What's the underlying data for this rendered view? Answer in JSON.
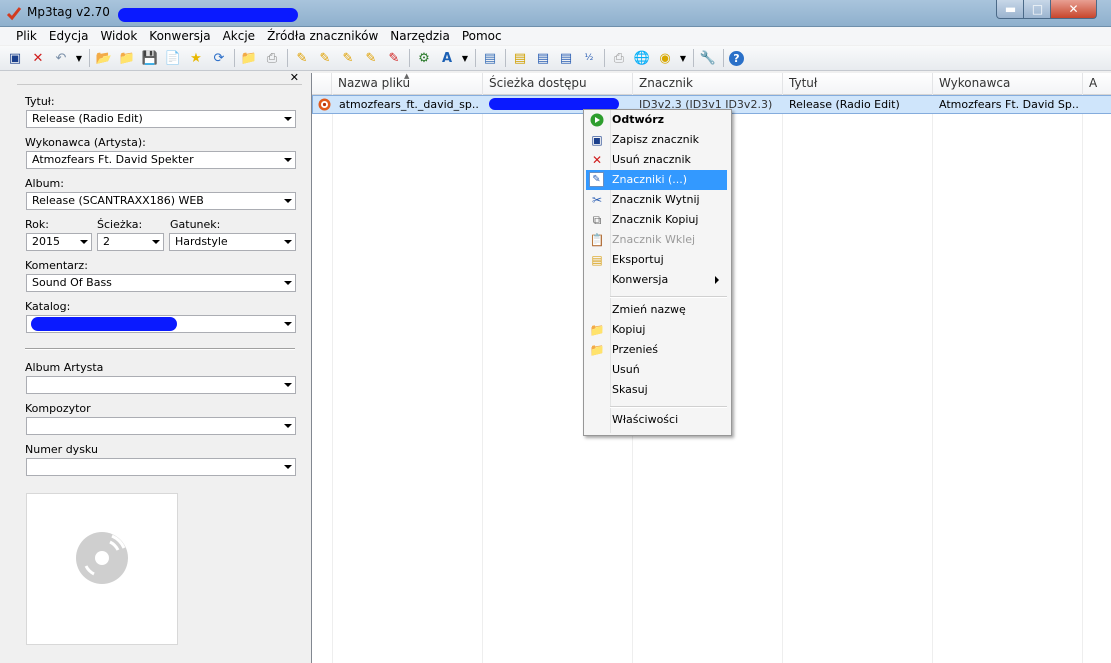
{
  "app": {
    "title": "Mp3tag v2.70"
  },
  "menu": [
    "Plik",
    "Edycja",
    "Widok",
    "Konwersja",
    "Akcje",
    "Źródła znaczników",
    "Narzędzia",
    "Pomoc"
  ],
  "fields": {
    "title": {
      "label": "Tytuł:",
      "value": "Release (Radio Edit)"
    },
    "artist": {
      "label": "Wykonawca (Artysta):",
      "value": "Atmozfears Ft. David Spekter"
    },
    "album": {
      "label": "Album:",
      "value": "Release (SCANTRAXX186) WEB"
    },
    "year": {
      "label": "Rok:",
      "value": "2015"
    },
    "track": {
      "label": "Ścieżka:",
      "value": "2"
    },
    "genre": {
      "label": "Gatunek:",
      "value": "Hardstyle"
    },
    "comment": {
      "label": "Komentarz:",
      "value": "Sound Of Bass"
    },
    "catalog": {
      "label": "Katalog:",
      "value": ""
    },
    "album_artist": {
      "label": "Album Artysta",
      "value": ""
    },
    "composer": {
      "label": "Kompozytor",
      "value": ""
    },
    "disc": {
      "label": "Numer dysku",
      "value": ""
    }
  },
  "columns": [
    "Nazwa pliku",
    "Ścieżka dostępu",
    "Znacznik",
    "Tytuł",
    "Wykonawca",
    "A"
  ],
  "row": {
    "filename": "atmozfears_ft._david_sp...",
    "path": "",
    "tag": "ID3v2.3 (ID3v1 ID3v2.3)",
    "title": "Release (Radio Edit)",
    "artist": "Atmozfears Ft. David Sp..."
  },
  "context_menu": {
    "play": "Odtwórz",
    "save_tag": "Zapisz znacznik",
    "remove_tag": "Usuń znacznik",
    "tags": "Znaczniki (...)",
    "cut_tag": "Znacznik Wytnij",
    "copy_tag": "Znacznik Kopiuj",
    "paste_tag": "Znacznik Wklej",
    "export": "Eksportuj",
    "convert": "Konwersja",
    "rename": "Zmień nazwę",
    "copy": "Kopiuj",
    "move": "Przenieś",
    "delete": "Usuń",
    "cancel": "Skasuj",
    "properties": "Właściwości"
  }
}
